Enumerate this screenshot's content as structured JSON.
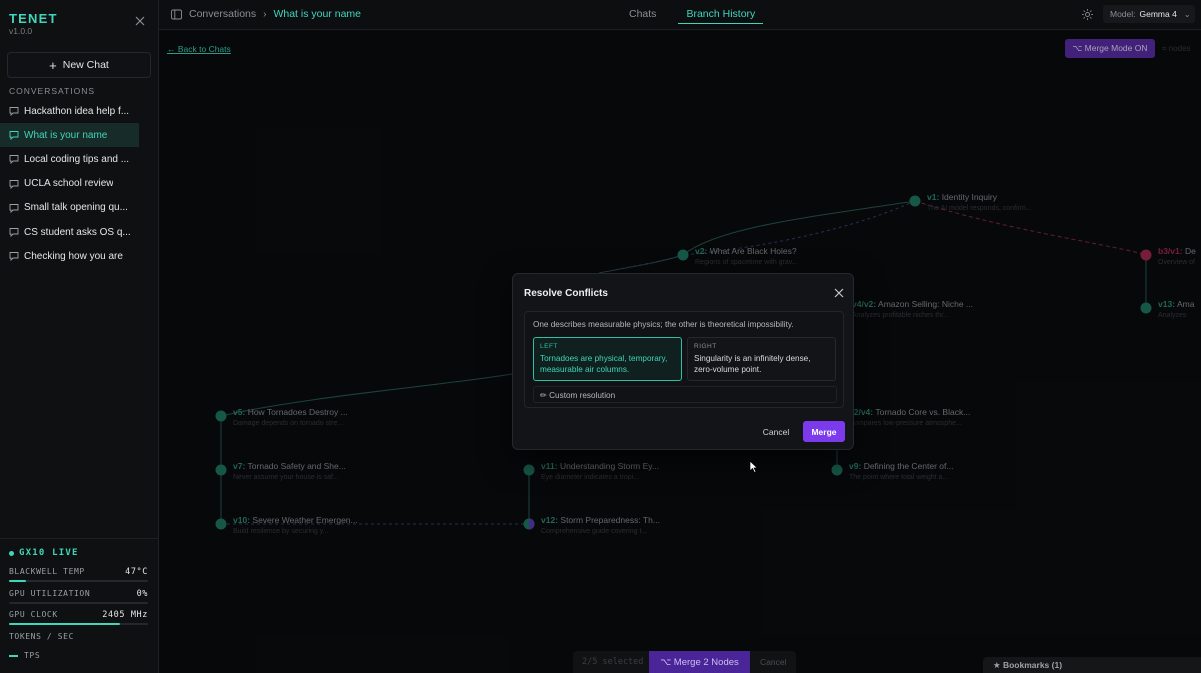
{
  "sidebar": {
    "brand": "TENET",
    "version": "v1.0.0",
    "new_chat_label": "New Chat",
    "section_title": "CONVERSATIONS",
    "conversations": [
      {
        "label": "Hackathon idea help f..."
      },
      {
        "label": "What is your name",
        "active": true
      },
      {
        "label": "Local coding tips and ..."
      },
      {
        "label": "UCLA school review"
      },
      {
        "label": "Small talk opening qu..."
      },
      {
        "label": "CS student asks OS q..."
      },
      {
        "label": "Checking how you are"
      }
    ],
    "stats": {
      "live_label": "GX10 LIVE",
      "temp_label": "BLACKWELL TEMP",
      "temp_value": "47°C",
      "temp_level": 0.12,
      "gpu_util_label": "GPU UTILIZATION",
      "gpu_util_value": "0%",
      "gpu_util_level": 0.0,
      "gpu_clock_label": "GPU CLOCK",
      "gpu_clock_value": "2405 MHz",
      "gpu_clock_level": 0.8,
      "tokens_label": "TOKENS / SEC",
      "tps_label": "TPS"
    }
  },
  "topbar": {
    "breadcrumb_root": "Conversations",
    "breadcrumb_current": "What is your name",
    "tabs": [
      {
        "label": "Chats"
      },
      {
        "label": "Branch History",
        "active": true
      }
    ],
    "model_label": "Model:",
    "model_value": "Gemma 4"
  },
  "canvas": {
    "back_link": "← Back to Chats",
    "merge_mode_label": "⌥ Merge Mode ON",
    "nodes_label": "nodes",
    "nodes": [
      {
        "id": "v1",
        "title": "Identity Inquiry",
        "sub": "The AI model responds, confirm..."
      },
      {
        "id": "v2",
        "title": "What Are Black Holes?",
        "sub": "Regions of spacetime with grav..."
      },
      {
        "id": "b3/v1",
        "title": "De",
        "sub": "Overview of"
      },
      {
        "id": "v4/v2",
        "title": "Amazon Selling: Niche ...",
        "sub": "Analyzes profitable niches thr..."
      },
      {
        "id": "v13",
        "title": "Ama",
        "sub": "Analyzes"
      },
      {
        "id": "v5",
        "title": "How Tornadoes Destroy ...",
        "sub": "Damage depends on tornado stre..."
      },
      {
        "id": "v2/v4",
        "title": "Tornado Core vs. Black...",
        "sub": "Compares low-pressure atmosphe..."
      },
      {
        "id": "v7",
        "title": "Tornado Safety and She...",
        "sub": "Never assume your house is saf..."
      },
      {
        "id": "v11",
        "title": "Understanding Storm Ey...",
        "sub": "Eye diameter indicates a tropi..."
      },
      {
        "id": "v9",
        "title": "Defining the Center of...",
        "sub": "The point where total weight a..."
      },
      {
        "id": "v10",
        "title": "Severe Weather Emergen...",
        "sub": "Build resilience by securing y..."
      },
      {
        "id": "v12",
        "title": "Storm Preparedness: Th...",
        "sub": "Comprehensive guide covering t..."
      }
    ]
  },
  "modal": {
    "title": "Resolve Conflicts",
    "description": "One describes measurable physics; the other is theoretical impossibility.",
    "left_tag": "LEFT",
    "left_text": "Tornadoes are physical, temporary, measurable air columns.",
    "right_tag": "RIGHT",
    "right_text": "Singularity is an infinitely dense, zero-volume point.",
    "custom_label": "✏ Custom resolution",
    "cancel_label": "Cancel",
    "merge_label": "Merge"
  },
  "bottom_bar": {
    "selected_label": "2/5 selected",
    "merge_nodes_label": "⌥ Merge 2 Nodes",
    "cancel_label": "Cancel"
  },
  "bookmarks_label": "★ Bookmarks (1)",
  "colors": {
    "accent": "#3fd6bd",
    "node": "#1f7a63",
    "merge_purple": "#7c3aed",
    "branch_red": "#c2325a"
  }
}
